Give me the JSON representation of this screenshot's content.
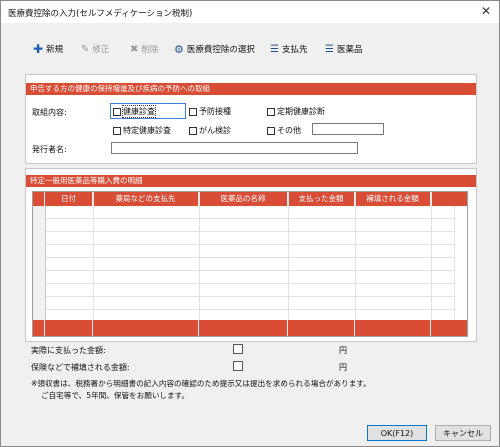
{
  "window": {
    "title": "医療費控除の入力(セルフメディケーション税制)",
    "close_glyph": "✕"
  },
  "toolbar": {
    "new_label": "新規",
    "edit_label": "修正",
    "delete_label": "削除",
    "select_label": "医療費控除の選択",
    "payee_label": "支払先",
    "medicine_label": "医薬品"
  },
  "section1": {
    "header": "申告する方の健康の保持増進及び疾病の予防への取組",
    "torikumi_label": "取組内容:",
    "options": [
      "健康診査",
      "予防接種",
      "定期健康診断",
      "特定健康診査",
      "がん検診",
      "その他"
    ],
    "other_value": "",
    "issuer_label": "発行者名:",
    "issuer_value": ""
  },
  "section2": {
    "header": "特定一般用医薬品等購入費の明細",
    "columns": [
      "日付",
      "薬局などの支払先",
      "医薬品の名称",
      "支払った金額",
      "補填される金額"
    ]
  },
  "summary": {
    "paid_label": "実際に支払った金額:",
    "paid_value": "",
    "paid_unit": "円",
    "reimb_label": "保険などで補填される金額:",
    "reimb_value": "",
    "reimb_unit": "円",
    "note1": "※領収書は、税務署から明細書の記入内容の確認のため提示又は提出を求められる場合があります。",
    "note2": "ご自宅等で、5年間、保管をお願いします。"
  },
  "buttons": {
    "ok_label": "OK(F12)",
    "cancel_label": "キャンセル"
  }
}
